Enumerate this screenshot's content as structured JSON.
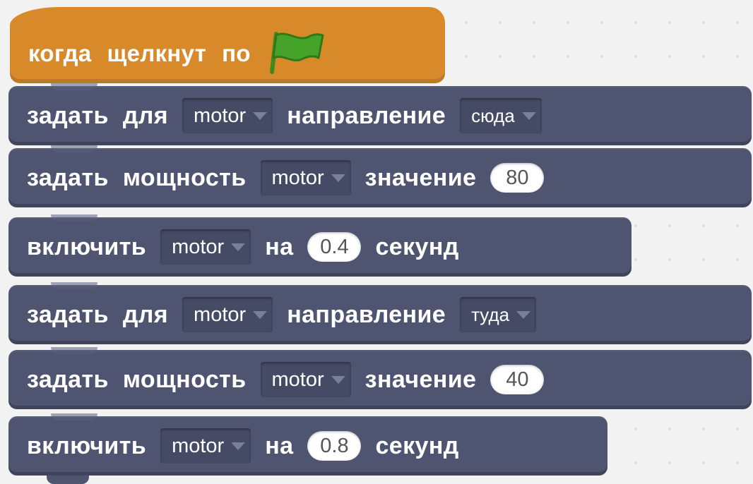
{
  "hat": {
    "words": [
      "когда",
      "щелкнут",
      "по"
    ],
    "icon": "green-flag-icon",
    "color": "#d88a2a"
  },
  "block_color": "#4f5570",
  "blocks": [
    {
      "k1": "задать",
      "k2": "для",
      "dd1": "motor",
      "k3": "направление",
      "dd2": "сюда"
    },
    {
      "k1": "задать",
      "k2": "мощность",
      "dd1": "motor",
      "k3": "значение",
      "num": "80"
    },
    {
      "k1": "включить",
      "dd1": "motor",
      "k2": "на",
      "num": "0.4",
      "k3": "секунд"
    },
    {
      "k1": "задать",
      "k2": "для",
      "dd1": "motor",
      "k3": "направление",
      "dd2": "туда"
    },
    {
      "k1": "задать",
      "k2": "мощность",
      "dd1": "motor",
      "k3": "значение",
      "num": "40"
    },
    {
      "k1": "включить",
      "dd1": "motor",
      "k2": "на",
      "num": "0.8",
      "k3": "секунд"
    }
  ]
}
